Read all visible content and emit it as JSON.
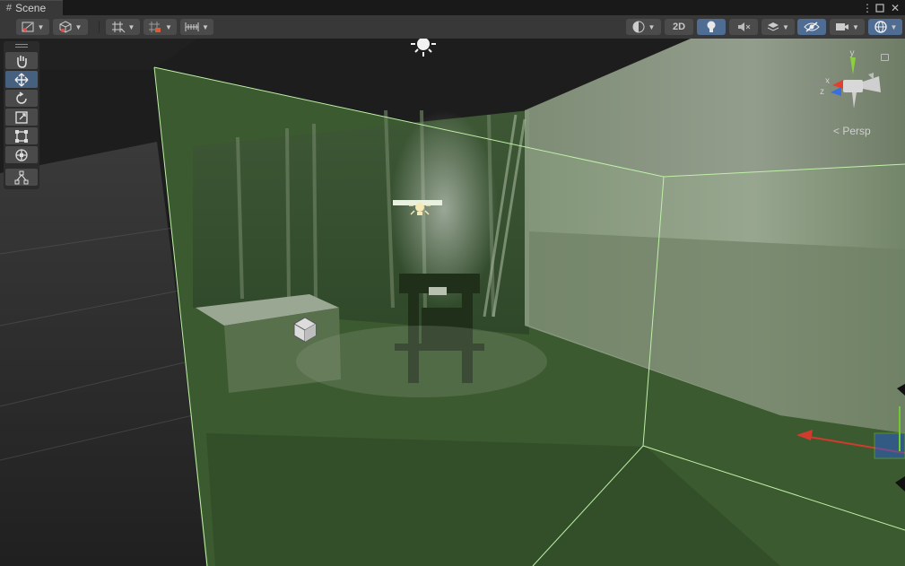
{
  "window": {
    "tab_title": "Scene",
    "tab_icon": "grid-hash-icon",
    "menu_icon": "kebab-menu-icon",
    "maximize_icon": "maximize-icon",
    "close_icon": "close-icon"
  },
  "toolbar": {
    "left": [
      {
        "icon": "draw-mode-icon",
        "dropdown": true
      },
      {
        "icon": "shading-cube-icon",
        "dropdown": true
      },
      {
        "icon": "grid-snap-icon",
        "dropdown": true
      },
      {
        "icon": "increment-snap-icon",
        "dropdown": true
      },
      {
        "icon": "rulers-icon",
        "dropdown": true
      }
    ],
    "right": {
      "render_mode_icon": "circle-half-icon",
      "mode_2d_label": "2D",
      "lighting_icon": "lightbulb-icon",
      "audio_icon": "audio-mute-icon",
      "effects_icon": "effects-stack-icon",
      "visibility_icon": "eye-hidden-icon",
      "camera_icon": "camera-icon",
      "gizmos_icon": "gizmo-globe-icon"
    },
    "colors": {
      "bar": "#383838",
      "button": "#4b4b4b",
      "active": "#4f6c93"
    }
  },
  "tools_overlay": {
    "tools": [
      {
        "name": "hand-tool",
        "icon": "hand-icon",
        "active": false
      },
      {
        "name": "move-tool",
        "icon": "move-arrows-icon",
        "active": true
      },
      {
        "name": "rotate-tool",
        "icon": "rotate-icon",
        "active": false
      },
      {
        "name": "scale-tool",
        "icon": "scale-icon",
        "active": false
      },
      {
        "name": "rect-tool",
        "icon": "rect-transform-icon",
        "active": false
      },
      {
        "name": "transform-tool",
        "icon": "transform-all-icon",
        "active": false
      }
    ],
    "custom_tool": {
      "name": "custom-editor-tool",
      "icon": "custom-tool-icon"
    }
  },
  "orientation_gizmo": {
    "projection_label": "Persp",
    "axis_y": "y",
    "axis_x": "x",
    "axis_z": "z",
    "colors": {
      "y": "#8cd13d",
      "x": "#e0402e",
      "z": "#3a6ee0"
    }
  },
  "scene": {
    "volume_color": "#3d5d2f",
    "volume_edge_color": "#b8f0a0",
    "icons": [
      "directional-light-icon",
      "point-light-icon",
      "gameobject-cube-icon"
    ],
    "handle_colors": {
      "x": "#d13b2e",
      "y": "#6ecc2e",
      "z": "#2a5bd6"
    }
  }
}
